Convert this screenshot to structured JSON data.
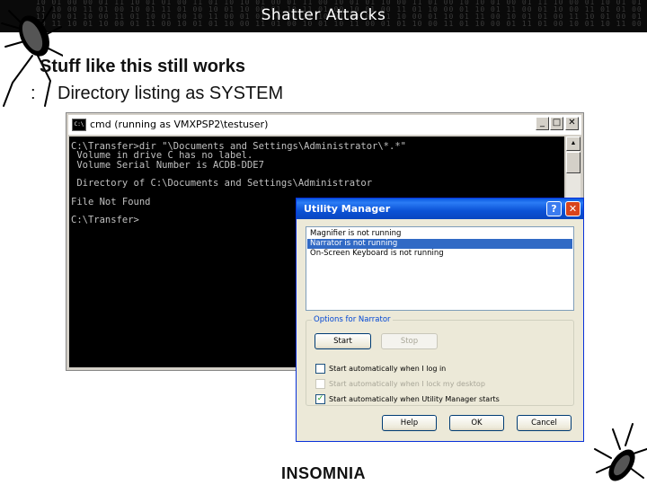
{
  "slide": {
    "title": "Shatter Attacks",
    "heading": "Stuff like this still works",
    "bullet_mark": ":",
    "bullet_text": "Directory listing as SYSTEM",
    "logo": "INSOMNIA"
  },
  "cmd_window": {
    "title": "cmd (running as VMXPSP2\\testuser)",
    "icon_text": "C:\\",
    "buttons": {
      "minimize": "_",
      "maximize": "□",
      "close": "✕"
    },
    "lines": [
      "C:\\Transfer>dir \"\\Documents and Settings\\Administrator\\*.*\"",
      " Volume in drive C has no label.",
      " Volume Serial Number is ACDB-DDE7",
      "",
      " Directory of C:\\Documents and Settings\\Administrator",
      "",
      "File Not Found",
      "",
      "C:\\Transfer>"
    ]
  },
  "utility_manager": {
    "title": "Utility Manager",
    "help_button": "?",
    "close_button": "✕",
    "list_items": [
      "Magnifier is not running",
      "Narrator is not running",
      "On-Screen Keyboard is not running"
    ],
    "selected_index": 1,
    "options_label": "Options for Narrator",
    "start_button": "Start",
    "stop_button": "Stop",
    "checkboxes": [
      {
        "label": "Start automatically when I log in",
        "checked": false,
        "enabled": true
      },
      {
        "label": "Start automatically when I lock my desktop",
        "checked": false,
        "enabled": false
      },
      {
        "label": "Start automatically when Utility Manager starts",
        "checked": true,
        "enabled": true
      }
    ],
    "help_label": "Help",
    "ok_label": "OK",
    "cancel_label": "Cancel"
  },
  "colors": {
    "header_bg": "#0a0a0a",
    "console_bg": "#000000",
    "console_fg": "#c0c0c0",
    "xp_title_blue": "#0b52d6",
    "selection_blue": "#316ac5"
  },
  "icons": [
    "cockroach-icon",
    "console-icon",
    "help-icon",
    "close-icon",
    "checkmark-icon"
  ]
}
